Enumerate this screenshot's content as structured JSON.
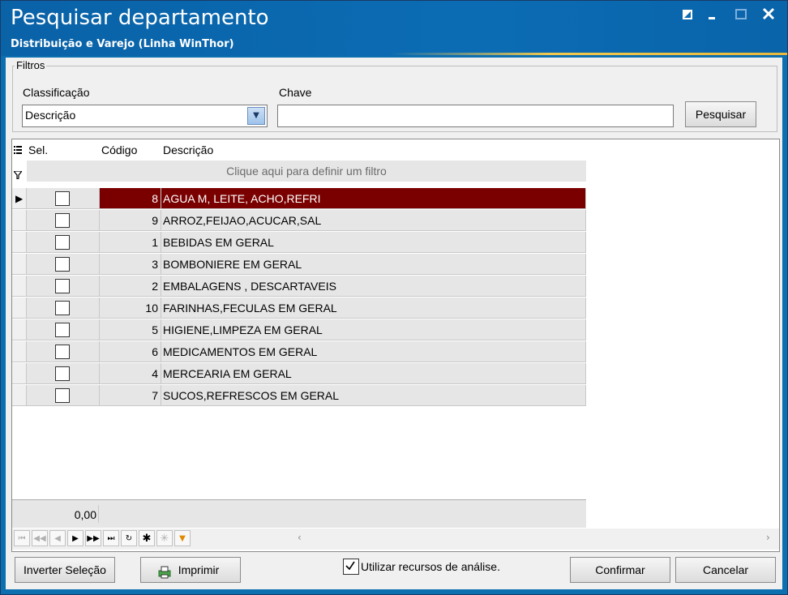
{
  "window": {
    "title": "Pesquisar departamento",
    "subtitle": "Distribuição e Varejo (Linha WinThor)"
  },
  "filters": {
    "group_label": "Filtros",
    "classificacao_label": "Classificação",
    "classificacao_value": "Descrição",
    "chave_label": "Chave",
    "chave_value": "",
    "search_button": "Pesquisar"
  },
  "grid": {
    "columns": [
      "Sel.",
      "Código",
      "Descrição"
    ],
    "filter_hint": "Clique aqui para definir um filtro",
    "rows": [
      {
        "code": "8",
        "desc": "AGUA M, LEITE, ACHO,REFRI",
        "selected": true
      },
      {
        "code": "9",
        "desc": "ARROZ,FEIJAO,ACUCAR,SAL"
      },
      {
        "code": "1",
        "desc": "BEBIDAS EM GERAL"
      },
      {
        "code": "3",
        "desc": "BOMBONIERE EM GERAL"
      },
      {
        "code": "2",
        "desc": "EMBALAGENS , DESCARTAVEIS"
      },
      {
        "code": "10",
        "desc": "FARINHAS,FECULAS EM GERAL"
      },
      {
        "code": "5",
        "desc": "HIGIENE,LIMPEZA EM GERAL"
      },
      {
        "code": "6",
        "desc": "MEDICAMENTOS EM GERAL"
      },
      {
        "code": "4",
        "desc": "MERCEARIA EM GERAL"
      },
      {
        "code": "7",
        "desc": "SUCOS,REFRESCOS EM GERAL"
      }
    ],
    "footer_total": "0,00"
  },
  "actions": {
    "invert_selection": "Inverter Seleção",
    "print": "Imprimir",
    "analysis_checkbox": "Utilizar recursos de análise.",
    "confirm": "Confirmar",
    "cancel": "Cancelar"
  },
  "colors": {
    "title_bg": "#0b6cb4",
    "selected_row": "#7a0000"
  }
}
